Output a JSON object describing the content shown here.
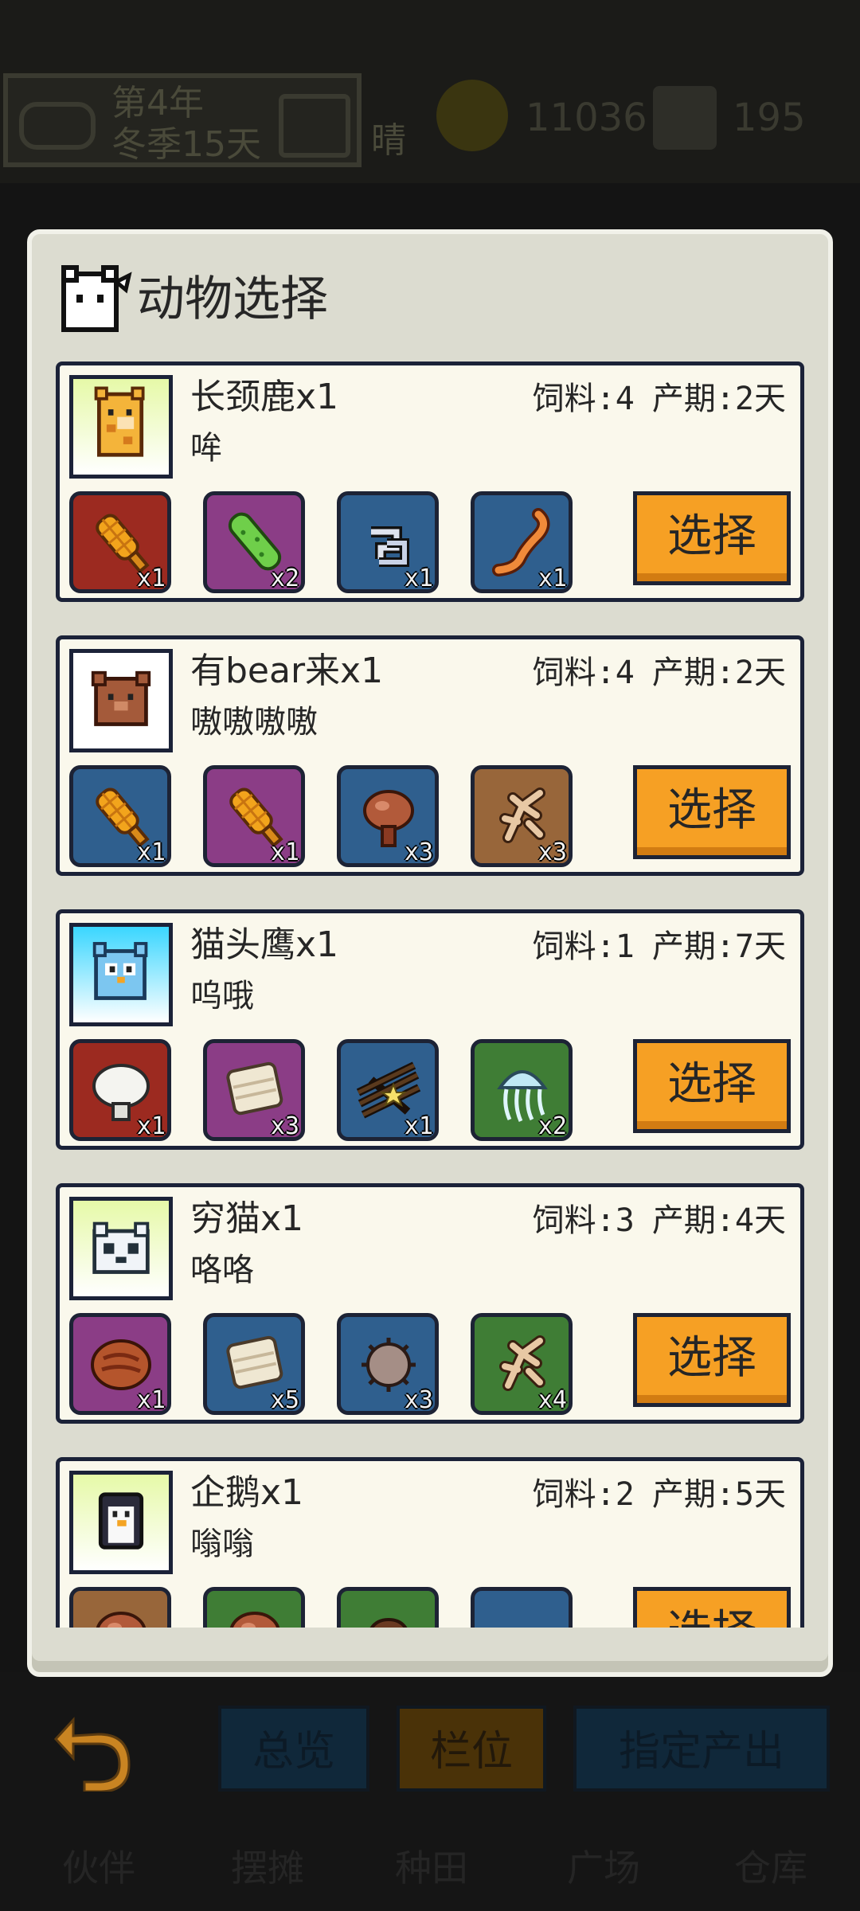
{
  "hud": {
    "year": "第4年",
    "season_day": "冬季15天",
    "weather": "晴",
    "coins": "11036",
    "tickets": "195"
  },
  "modal": {
    "title": "动物选择",
    "icon": "cat-face-icon"
  },
  "colors": {
    "select_button": "#f6a024",
    "card_border": "#1b2238",
    "card_bg": "#faf8ec"
  },
  "animals": [
    {
      "name": "长颈鹿x1",
      "sound": "哞",
      "feed": "饲料:4",
      "period": "产期:2天",
      "avatar": "giraffe",
      "select": "选择",
      "items": [
        {
          "icon": "corn-icon",
          "bg": "red",
          "qty": "x1"
        },
        {
          "icon": "cucumber-icon",
          "bg": "purple",
          "qty": "x2"
        },
        {
          "icon": "chain-icon",
          "bg": "blue",
          "qty": "x1"
        },
        {
          "icon": "worm-icon",
          "bg": "blue",
          "qty": "x1"
        }
      ]
    },
    {
      "name": "有bear来x1",
      "sound": "嗷嗷嗷嗷",
      "feed": "饲料:4",
      "period": "产期:2天",
      "avatar": "bear",
      "select": "选择",
      "items": [
        {
          "icon": "corn-icon",
          "bg": "blue",
          "qty": "x1"
        },
        {
          "icon": "corn-icon",
          "bg": "purple",
          "qty": "x1"
        },
        {
          "icon": "mushroom-icon",
          "bg": "blue",
          "qty": "x3"
        },
        {
          "icon": "ginseng-icon",
          "bg": "brown",
          "qty": "x3"
        }
      ]
    },
    {
      "name": "猫头鹰x1",
      "sound": "呜哦",
      "feed": "饲料:1",
      "period": "产期:7天",
      "avatar": "owl",
      "select": "选择",
      "items": [
        {
          "icon": "white-mushroom-icon",
          "bg": "red",
          "qty": "x1"
        },
        {
          "icon": "cloth-icon",
          "bg": "purple",
          "qty": "x3"
        },
        {
          "icon": "twigs-icon",
          "bg": "blue",
          "qty": "x1"
        },
        {
          "icon": "jellyfish-icon",
          "bg": "green",
          "qty": "x2"
        }
      ]
    },
    {
      "name": "穷猫x1",
      "sound": "咯咯",
      "feed": "饲料:3",
      "period": "产期:4天",
      "avatar": "cat",
      "select": "选择",
      "items": [
        {
          "icon": "meat-icon",
          "bg": "purple",
          "qty": "x1"
        },
        {
          "icon": "cloth-icon",
          "bg": "blue",
          "qty": "x5"
        },
        {
          "icon": "urchin-icon",
          "bg": "blue",
          "qty": "x3"
        },
        {
          "icon": "ginseng-icon",
          "bg": "green",
          "qty": "x4"
        }
      ]
    },
    {
      "name": "企鹅x1",
      "sound": "嗡嗡",
      "feed": "饲料:2",
      "period": "产期:5天",
      "avatar": "penguin",
      "select": "选择",
      "items": [
        {
          "icon": "mushroom-icon",
          "bg": "brown",
          "qty": ""
        },
        {
          "icon": "mushroom-icon",
          "bg": "green",
          "qty": ""
        },
        {
          "icon": "nut-icon",
          "bg": "green",
          "qty": ""
        },
        {
          "icon": "crystal-icon",
          "bg": "blue",
          "qty": ""
        }
      ]
    }
  ],
  "bottom": {
    "overview": "总览",
    "slot": "栏位",
    "output": "指定产出",
    "nav": [
      "伙伴",
      "摆摊",
      "种田",
      "广场",
      "仓库"
    ]
  }
}
